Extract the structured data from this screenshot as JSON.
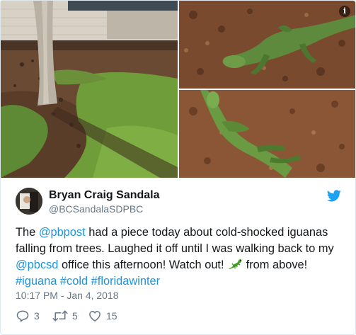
{
  "tweet": {
    "author_name": "Bryan Craig Sandala",
    "author_handle": "@BCSandalaSDPBC",
    "text": {
      "part1": "The ",
      "mention1": "@pbpost",
      "part2": " had a piece today about cold-shocked iguanas falling from trees. Laughed it off until I was walking back to my ",
      "mention2": "@pbcsd",
      "part3": " office this afternoon! Watch out! ",
      "emoji": "lizard-emoji",
      "part4": " from above!",
      "hashtag1": "#iguana",
      "hashtag2": "#cold",
      "hashtag3": "#floridawinter"
    },
    "timestamp": "10:17 PM - Jan 4, 2018",
    "replies": "3",
    "retweets": "5",
    "likes": "15"
  },
  "media": {
    "photos": [
      "tree-trunk-grass-photo",
      "iguana-on-mulch-photo",
      "iguana-closeup-photo"
    ],
    "info_label": "i"
  },
  "icons": {
    "brand": "twitter-bird-icon",
    "reply": "reply-icon",
    "retweet": "retweet-icon",
    "like": "heart-icon"
  },
  "colors": {
    "link": "#1b95e0",
    "text": "#14171a",
    "muted": "#657786",
    "brand": "#1da1f2"
  }
}
